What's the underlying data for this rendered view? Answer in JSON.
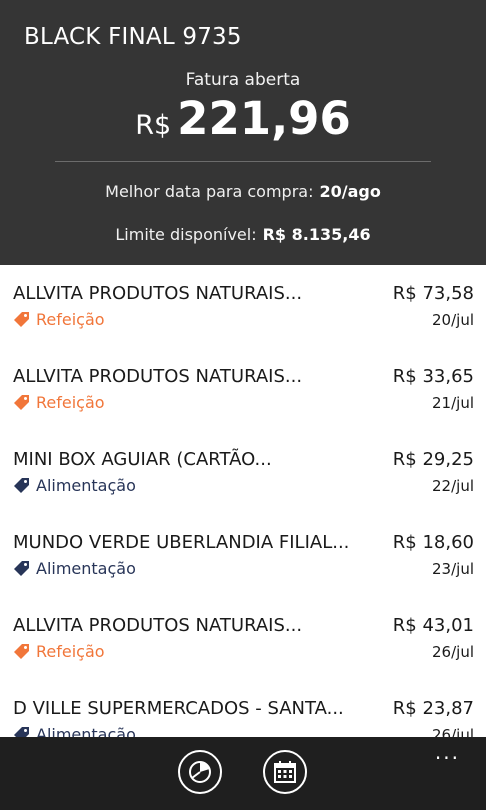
{
  "header": {
    "card_name": "BLACK FINAL 9735",
    "invoice_label": "Fatura aberta",
    "currency": "R$",
    "amount": "221,96",
    "best_date_label": "Melhor data para compra:",
    "best_date_value": "20/ago",
    "limit_label": "Limite disponível:",
    "limit_value": "R$ 8.135,46"
  },
  "transactions": [
    {
      "name": "ALLVITA PRODUTOS NATURAIS...",
      "amount": "R$ 73,58",
      "category": "Refeição",
      "date": "20/jul"
    },
    {
      "name": "ALLVITA PRODUTOS NATURAIS...",
      "amount": "R$ 33,65",
      "category": "Refeição",
      "date": "21/jul"
    },
    {
      "name": "MINI BOX AGUIAR (CARTÃO...",
      "amount": "R$ 29,25",
      "category": "Alimentação",
      "date": "22/jul"
    },
    {
      "name": "MUNDO VERDE UBERLANDIA FILIAL...",
      "amount": "R$ 18,60",
      "category": "Alimentação",
      "date": "23/jul"
    },
    {
      "name": "ALLVITA PRODUTOS NATURAIS...",
      "amount": "R$ 43,01",
      "category": "Refeição",
      "date": "26/jul"
    },
    {
      "name": "D VILLE SUPERMERCADOS - SANTA...",
      "amount": "R$ 23,87",
      "category": "Alimentação",
      "date": "26/jul"
    }
  ],
  "appbar": {
    "buttons": [
      {
        "icon": "pie-chart-icon"
      },
      {
        "icon": "calendar-icon"
      }
    ],
    "more": "..."
  },
  "colors": {
    "header_bg": "#353535",
    "refeicao": "#f1763a",
    "alimentacao": "#283558",
    "appbar_bg": "#1f1f1f"
  }
}
